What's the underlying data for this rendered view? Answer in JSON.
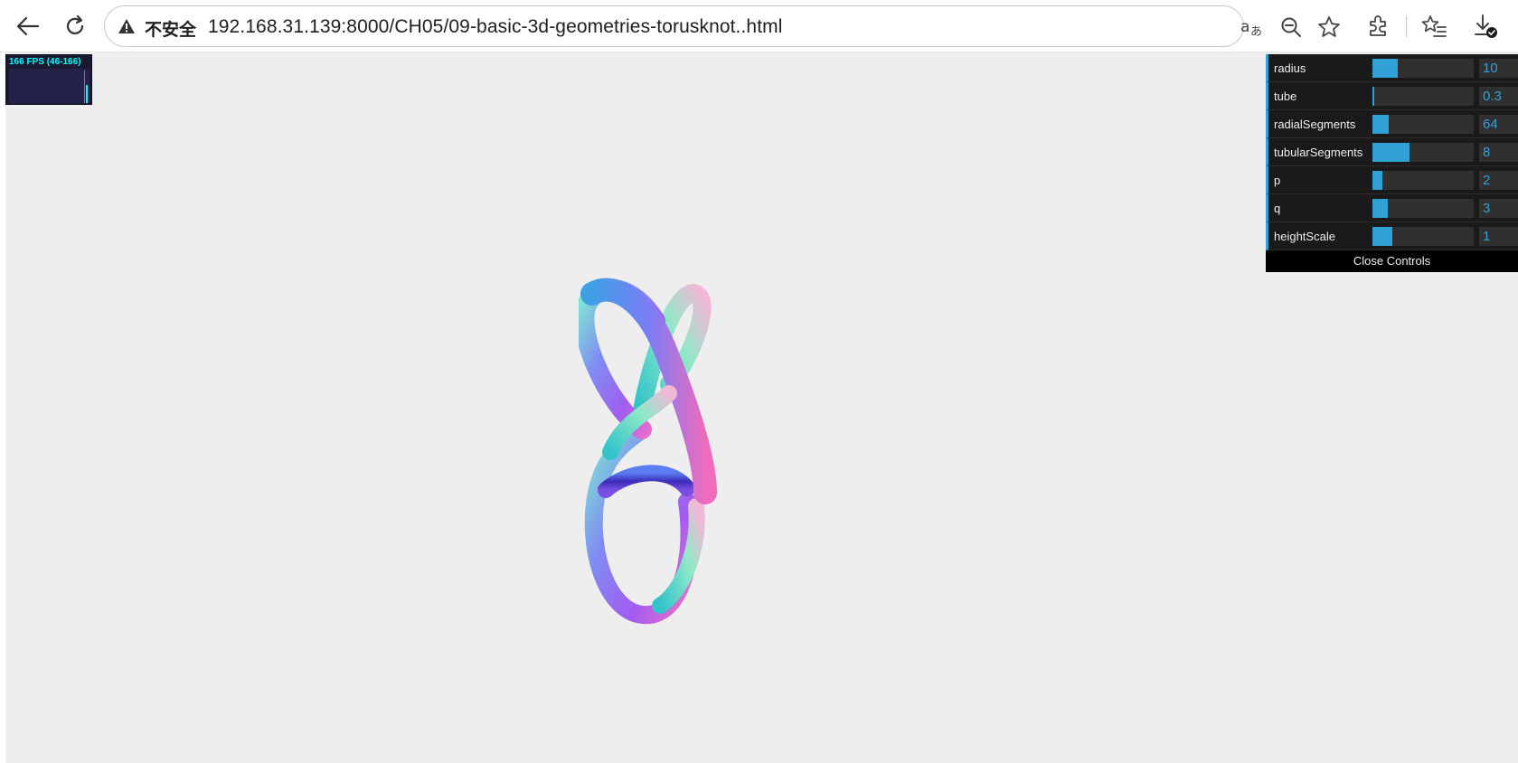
{
  "browser": {
    "security_label": "不安全",
    "url": "192.168.31.139:8000/CH05/09-basic-3d-geometries-torusknot..html"
  },
  "stats": {
    "fps_text": "166 FPS (46-166)"
  },
  "controls": {
    "items": [
      {
        "label": "radius",
        "value": "10",
        "fill": 0.25
      },
      {
        "label": "tube",
        "value": "0.3",
        "fill": 0.01
      },
      {
        "label": "radialSegments",
        "value": "64",
        "fill": 0.16
      },
      {
        "label": "tubularSegments",
        "value": "8",
        "fill": 0.37
      },
      {
        "label": "p",
        "value": "2",
        "fill": 0.1
      },
      {
        "label": "q",
        "value": "3",
        "fill": 0.15
      },
      {
        "label": "heightScale",
        "value": "1",
        "fill": 0.2
      }
    ],
    "close_label": "Close Controls"
  },
  "colors": {
    "gui_accent": "#2fa1d6",
    "stats_text": "#00ffff",
    "page_bg": "#eeeeee"
  },
  "icons": [
    "back-icon",
    "reload-icon",
    "warning-icon",
    "translate-icon",
    "zoom-out-icon",
    "favorite-star-icon",
    "extensions-icon",
    "favorites-list-icon",
    "downloads-icon"
  ]
}
